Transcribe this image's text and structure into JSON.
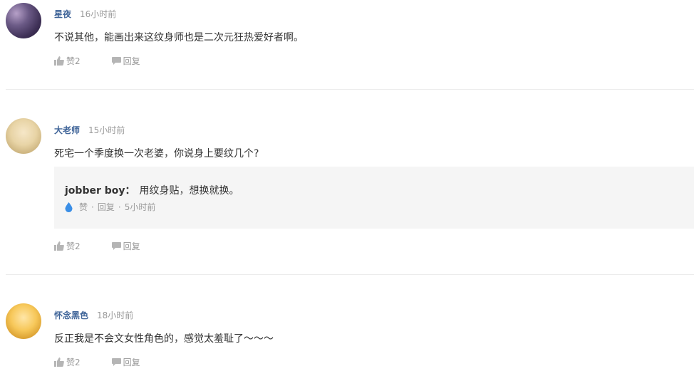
{
  "comments": [
    {
      "user": "星夜",
      "time": "16小时前",
      "text": "不说其他，能画出来这纹身师也是二次元狂热爱好者啊。",
      "like_label": "赞2",
      "reply_label": "回复"
    },
    {
      "user": "大老师",
      "time": "15小时前",
      "text": "死宅一个季度换一次老婆，你说身上要纹几个?",
      "like_label": "赞2",
      "reply_label": "回复",
      "sub_reply": {
        "user": "jobber boy：",
        "text": "用纹身贴，想换就换。",
        "like_label": "赞",
        "reply_label": "回复",
        "time": "5小时前",
        "sep": "·"
      }
    },
    {
      "user": "怀念黑色",
      "time": "18小时前",
      "text": "反正我是不会文女性角色的，感觉太羞耻了～～～",
      "like_label": "赞2",
      "reply_label": "回复"
    }
  ],
  "colors": {
    "username": "#406599",
    "muted": "#999999",
    "reply_bg": "#f5f5f5",
    "drop": "#3a8ee6"
  },
  "icons": {
    "like": "thumbs-up-icon",
    "reply": "speech-bubble-icon",
    "sub_reply": "water-drop-icon"
  }
}
